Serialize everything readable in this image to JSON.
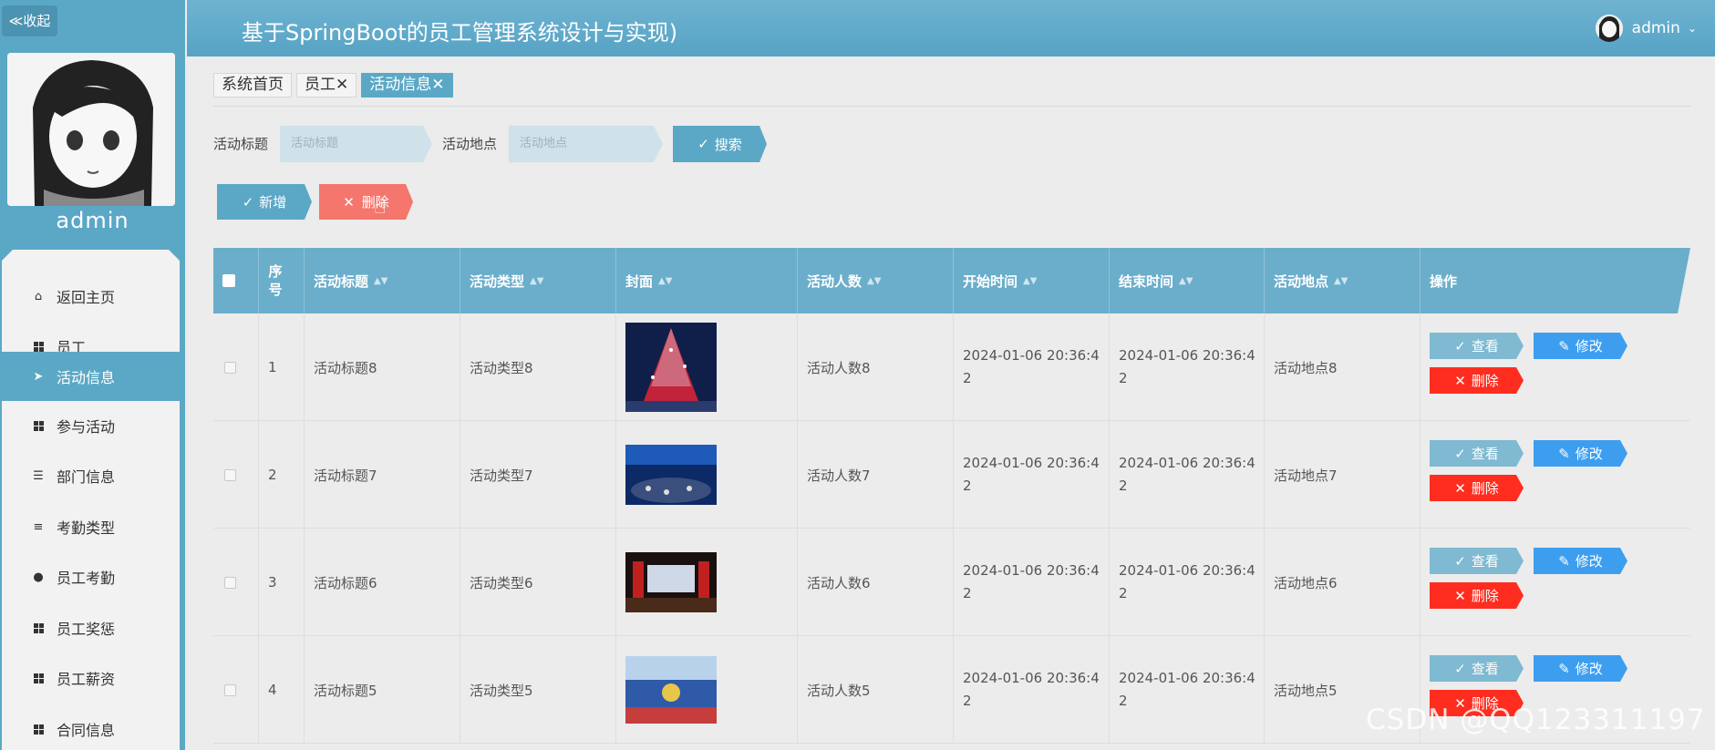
{
  "sidebar": {
    "collapse_label": "≪收起",
    "username": "admin",
    "menu": [
      {
        "label": "返回主页",
        "icon": "home-icon"
      },
      {
        "label": "员工",
        "icon": "grid-icon"
      },
      {
        "label": "活动信息",
        "icon": "paper-plane-icon"
      },
      {
        "label": "参与活动",
        "icon": "grid-icon"
      },
      {
        "label": "部门信息",
        "icon": "sliders-icon"
      },
      {
        "label": "考勤类型",
        "icon": "list-icon"
      },
      {
        "label": "员工考勤",
        "icon": "user-icon"
      },
      {
        "label": "员工奖惩",
        "icon": "grid-icon"
      },
      {
        "label": "员工薪资",
        "icon": "grid-icon"
      },
      {
        "label": "合同信息",
        "icon": "grid-icon"
      }
    ],
    "active_index": 2
  },
  "header": {
    "title": "基于SpringBoot的员工管理系统设计与实现)",
    "user": "admin"
  },
  "tabs": [
    {
      "label": "系统首页"
    },
    {
      "label": "员工✕"
    },
    {
      "label": "活动信息✕"
    }
  ],
  "search": {
    "title_label": "活动标题",
    "title_placeholder": "活动标题",
    "place_label": "活动地点",
    "place_placeholder": "活动地点",
    "search_button": "搜索"
  },
  "actions": {
    "add_button": "新增",
    "delete_button": "删除"
  },
  "table": {
    "headers": [
      "序号",
      "活动标题",
      "活动类型",
      "封面",
      "活动人数",
      "开始时间",
      "结束时间",
      "活动地点",
      "操作"
    ],
    "rows": [
      {
        "index": "1",
        "title": "活动标题8",
        "type": "活动类型8",
        "count": "活动人数8",
        "start": "2024-01-06 20:36:4 2",
        "end": "2024-01-06 20:36:4 2",
        "place": "活动地点8"
      },
      {
        "index": "2",
        "title": "活动标题7",
        "type": "活动类型7",
        "count": "活动人数7",
        "start": "2024-01-06 20:36:4 2",
        "end": "2024-01-06 20:36:4 2",
        "place": "活动地点7"
      },
      {
        "index": "3",
        "title": "活动标题6",
        "type": "活动类型6",
        "count": "活动人数6",
        "start": "2024-01-06 20:36:4 2",
        "end": "2024-01-06 20:36:4 2",
        "place": "活动地点6"
      },
      {
        "index": "4",
        "title": "活动标题5",
        "type": "活动类型5",
        "count": "活动人数5",
        "start": "2024-01-06 20:36:4 2",
        "end": "2024-01-06 20:36:4 2",
        "place": "活动地点5"
      }
    ],
    "row_actions": {
      "view": "查看",
      "edit": "修改",
      "delete": "删除"
    }
  },
  "watermark": "CSDN @QQ123311197"
}
